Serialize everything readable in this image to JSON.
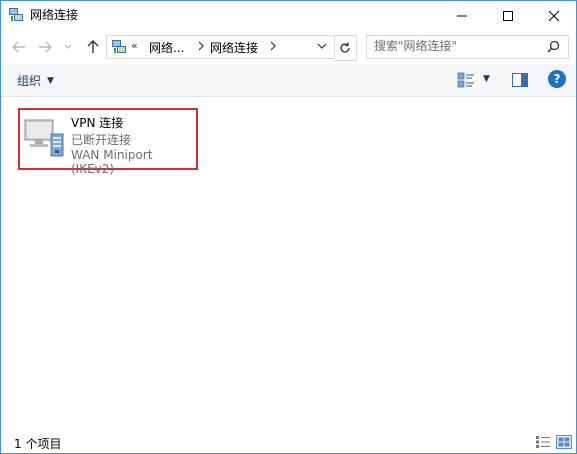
{
  "window": {
    "title": "网络连接",
    "title_icon": "network-connections-icon"
  },
  "controls": {
    "minimize": "minimize-icon",
    "maximize": "maximize-icon",
    "close": "close-icon"
  },
  "nav": {
    "back": "back-arrow-icon",
    "forward": "forward-arrow-icon",
    "recent": "chevron-down-icon",
    "up": "up-arrow-icon"
  },
  "address": {
    "overflow": "«",
    "crumbs": [
      "网络...",
      "网络连接"
    ],
    "dropdown": "chevron-down-icon",
    "refresh": "refresh-icon"
  },
  "search": {
    "placeholder": "搜索\"网络连接\"",
    "icon": "search-icon"
  },
  "toolbar": {
    "organize_label": "组织",
    "views": "view-options-icon",
    "preview_pane": "preview-pane-icon",
    "help": "?"
  },
  "items": [
    {
      "name": "VPN 连接",
      "status": "已断开连接",
      "device": "WAN Miniport (IKEv2)",
      "icon": "vpn-connection-icon"
    }
  ],
  "statusbar": {
    "count": "1 个项目",
    "details_view": "details-view-icon",
    "large_icons_view": "large-icons-view-icon"
  },
  "colors": {
    "accent": "#1e6fc7",
    "highlight_border": "#d62f2f",
    "window_border": "#4a8dd8"
  }
}
